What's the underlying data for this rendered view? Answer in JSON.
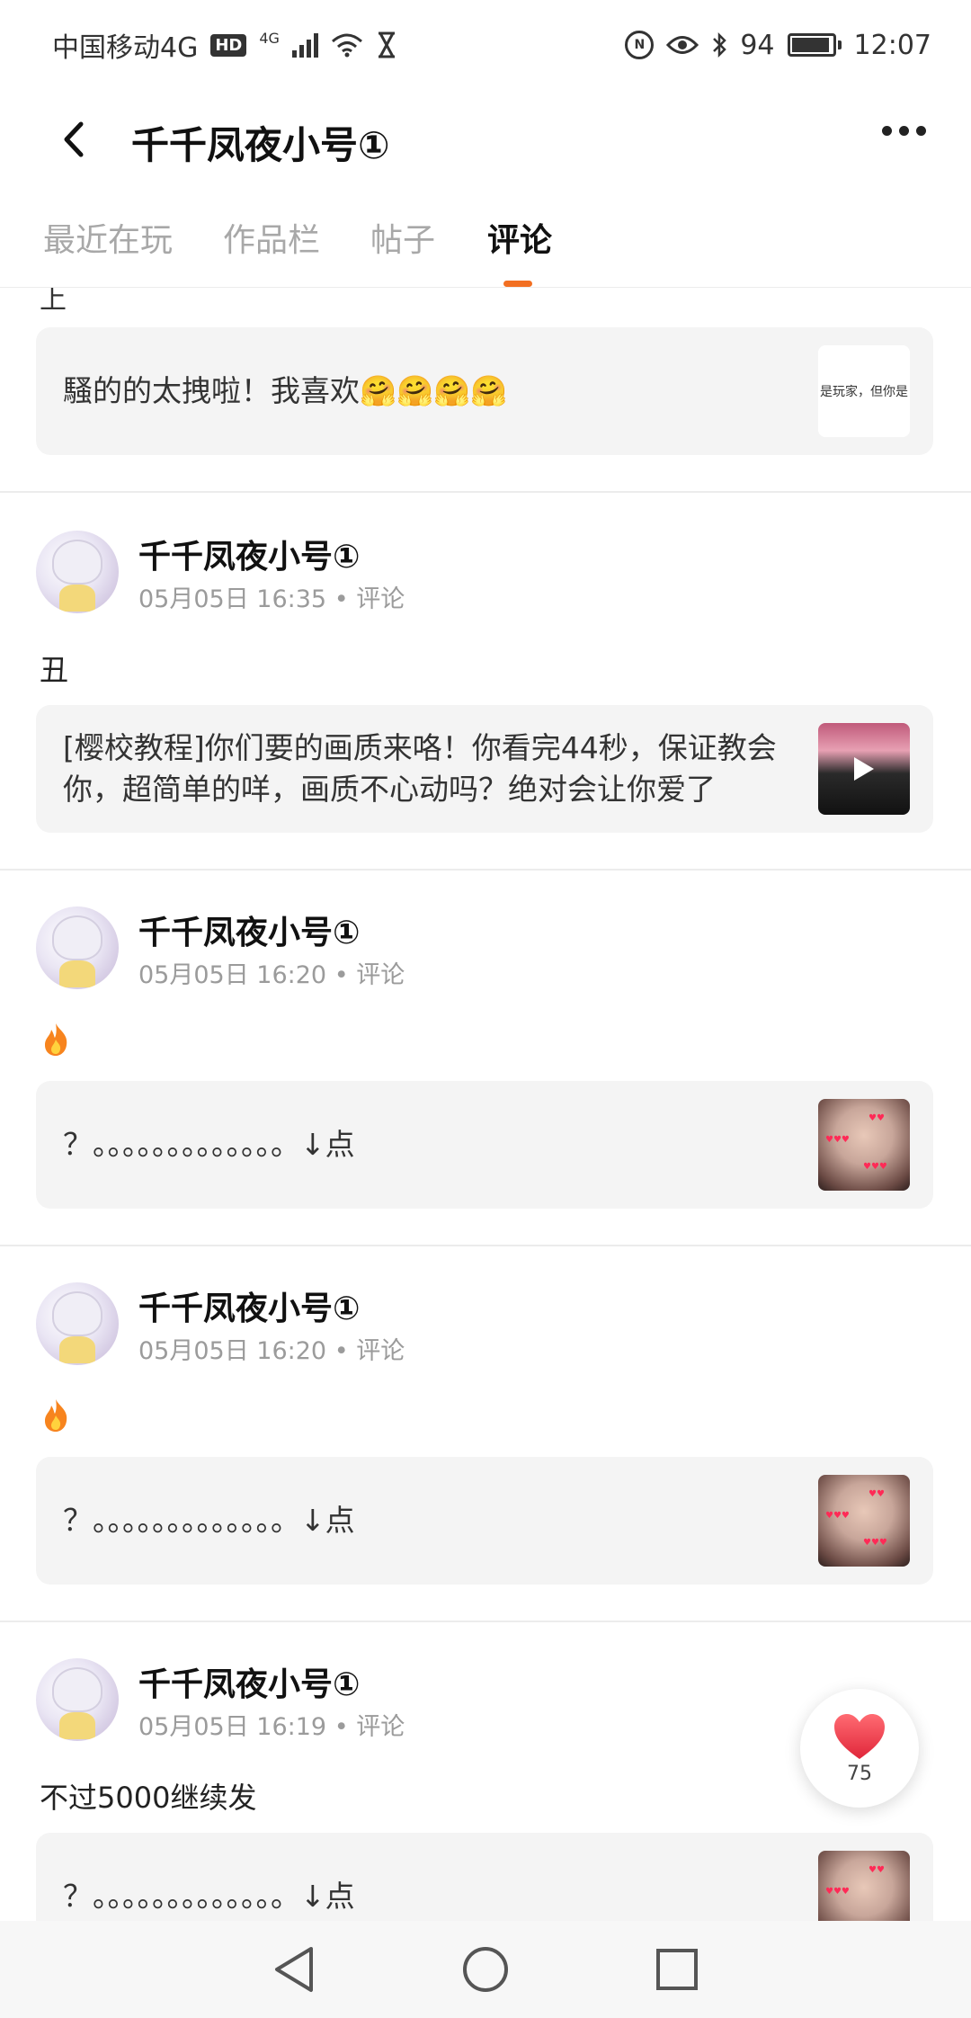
{
  "status_bar": {
    "carrier": "中国移动4G",
    "hd": "HD",
    "net_type": "4G",
    "battery_level": "94",
    "time": "12:07"
  },
  "header": {
    "title": "千千凤夜小号①"
  },
  "tabs": [
    {
      "label": "最近在玩"
    },
    {
      "label": "作品栏"
    },
    {
      "label": "帖子"
    },
    {
      "label": "评论"
    }
  ],
  "active_tab": "评论",
  "partial": {
    "top_text": "上",
    "card_text": "騷的的太拽啦！我喜欢🤗🤗🤗🤗",
    "thumb_text": "是玩家，但你是"
  },
  "posts": [
    {
      "username": "千千凤夜小号①",
      "date": "05月05日 16:35",
      "type": "评论",
      "comment": "丑",
      "card_text": "[樱校教程]你们要的画质来咯！你看完44秒，保证教会你，超简单的咩，画质不心动吗？绝对会让你爱了"
    },
    {
      "username": "千千凤夜小号①",
      "date": "05月05日 16:20",
      "type": "评论",
      "comment": "",
      "card_text": "？。。。。。。。。。。。。。↓点"
    },
    {
      "username": "千千凤夜小号①",
      "date": "05月05日 16:20",
      "type": "评论",
      "comment": "",
      "card_text": "？。。。。。。。。。。。。。↓点"
    },
    {
      "username": "千千凤夜小号①",
      "date": "05月05日 16:19",
      "type": "评论",
      "comment": "不过5000继续发",
      "card_text": "？。。。。。。。。。。。。。↓点"
    }
  ],
  "meta_separator": "•",
  "like_button": {
    "count": "75"
  },
  "colors": {
    "accent": "#f26f22",
    "card_bg": "#f4f4f4",
    "heart": "#f0434e"
  }
}
